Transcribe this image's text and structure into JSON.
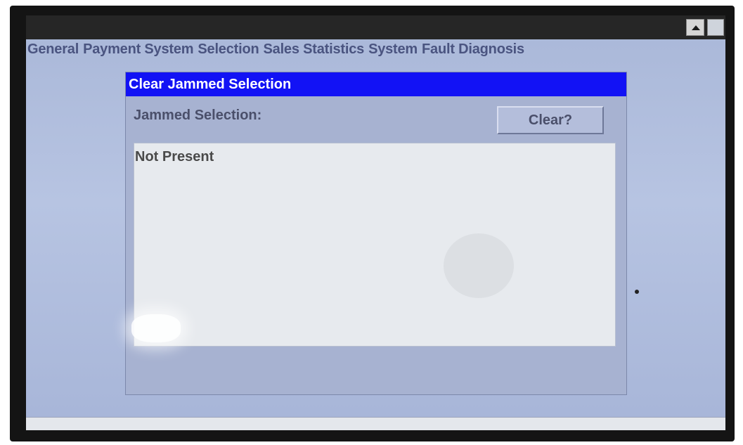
{
  "menubar": {
    "items": [
      {
        "label": "General"
      },
      {
        "label": "Payment System"
      },
      {
        "label": "Selection"
      },
      {
        "label": "Sales Statistics"
      },
      {
        "label": "System"
      },
      {
        "label": "Fault Diagnosis"
      }
    ]
  },
  "titlebar": {
    "scroll_icon": "triangle-up-icon"
  },
  "dialog": {
    "title": "Clear Jammed Selection",
    "jammed_label": "Jammed Selection:",
    "clear_button": "Clear?",
    "result_text": "Not Present"
  },
  "colors": {
    "dialog_title_bg": "#1212f5",
    "screen_bg": "#b7c4e2",
    "menu_text": "#4a5480"
  }
}
